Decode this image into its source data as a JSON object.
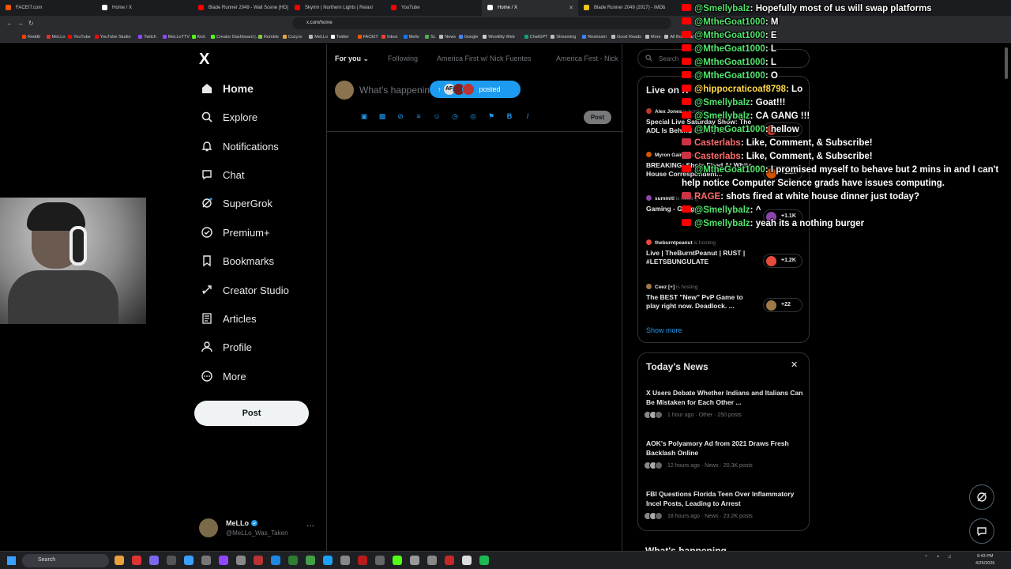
{
  "browser": {
    "tabs": [
      {
        "title": "FACEIT.com",
        "color": "#ff5500"
      },
      {
        "title": "Home / X",
        "color": "#ffffff"
      },
      {
        "title": "Blade Runner 2049 - Wall Scene [HD]",
        "color": "#ff0000"
      },
      {
        "title": "Skyrim | Northern Lights | Relaxi",
        "color": "#ff0000"
      },
      {
        "title": "YouTube",
        "color": "#ff0000"
      },
      {
        "title": "Home / X",
        "color": "#ffffff",
        "active": true
      },
      {
        "title": "Blade Runner 2049 (2017) - IMDb",
        "color": "#f5c518"
      }
    ],
    "url": "x.com/home",
    "bookmarks": [
      {
        "label": "Reddit",
        "color": "#ff4500"
      },
      {
        "label": "MeLLo",
        "color": "#d33"
      },
      {
        "label": "YouTube",
        "color": "#ff0000"
      },
      {
        "label": "YouTube Studio",
        "color": "#ff0000"
      },
      {
        "label": "Twitch",
        "color": "#9146ff"
      },
      {
        "label": "MeLLoTTV",
        "color": "#9146ff"
      },
      {
        "label": "Kick",
        "color": "#53fc18"
      },
      {
        "label": "Creator Dashboard |...",
        "color": "#53fc18"
      },
      {
        "label": "Rumble",
        "color": "#85c742"
      },
      {
        "label": "Cozy.tv",
        "color": "#e8a33d"
      },
      {
        "label": "MeLLo",
        "color": "#bbbbbb"
      },
      {
        "label": "Twitter",
        "color": "#ffffff"
      },
      {
        "label": "FACEIT",
        "color": "#ff5500"
      },
      {
        "label": "Inbox",
        "color": "#ea4335"
      },
      {
        "label": "Mello",
        "color": "#1877f2"
      },
      {
        "label": "SL",
        "color": "#4caf50"
      },
      {
        "label": "News",
        "color": "#bbbbbb"
      },
      {
        "label": "Google",
        "color": "#4285f4"
      },
      {
        "label": "Wootility Web",
        "color": "#cccccc"
      },
      {
        "label": "ChatGPT",
        "color": "#10a37f"
      },
      {
        "label": "Streaming",
        "color": "#bbbbbb"
      },
      {
        "label": "Restream",
        "color": "#3b82f6"
      },
      {
        "label": "Good Reads",
        "color": "#bbbbbb"
      },
      {
        "label": "More",
        "color": "#bbbbbb"
      },
      {
        "label": "All Bookmarks",
        "color": "#bbbbbb"
      }
    ]
  },
  "sidebar": {
    "logo": "X",
    "items": [
      {
        "label": "Home",
        "icon": "home-icon"
      },
      {
        "label": "Explore",
        "icon": "search-icon"
      },
      {
        "label": "Notifications",
        "icon": "bell-icon"
      },
      {
        "label": "Chat",
        "icon": "chat-icon"
      },
      {
        "label": "SuperGrok",
        "icon": "grok-icon"
      },
      {
        "label": "Premium+",
        "icon": "verified-icon"
      },
      {
        "label": "Bookmarks",
        "icon": "bookmark-icon"
      },
      {
        "label": "Creator Studio",
        "icon": "rocket-icon"
      },
      {
        "label": "Articles",
        "icon": "article-icon"
      },
      {
        "label": "Profile",
        "icon": "person-icon"
      },
      {
        "label": "More",
        "icon": "more-circle-icon"
      }
    ],
    "post_label": "Post",
    "account": {
      "name": "MeLLo",
      "handle": "@MeLLo_Was_Taken"
    }
  },
  "timeline": {
    "tabs": [
      {
        "label": "For you",
        "selected": true
      },
      {
        "label": "Following"
      },
      {
        "label": "America First w/ Nick Fuentes"
      },
      {
        "label": "America First - Nick"
      }
    ],
    "composer_placeholder": "What's happening?",
    "posted_label": "posted",
    "posted_avatar_text": "AF",
    "post_label": "Post"
  },
  "right": {
    "search_placeholder": "Search",
    "live_title": "Live on X",
    "live": [
      {
        "host": "Alex Jones",
        "status": "is hosting",
        "title": "Special Live Saturday Show: The ADL Is Behind Gallery B...",
        "count": "+1.6K",
        "color": "#c0392b"
      },
      {
        "host": "Myron Gaines",
        "status": "is hosting",
        "title": "BREAKING: Shots Fired At White House Correspondent...",
        "count": "+1.1K",
        "color": "#d35400"
      },
      {
        "host": "summitl",
        "status": "is hosting",
        "title": "Gaming - Gungeon 2",
        "count": "+1.1K",
        "color": "#8e44ad"
      },
      {
        "host": "theburntpeanut",
        "status": "is hosting",
        "title": "Live | TheBurntPeanut | RUST | #LETSBUNGULATE",
        "count": "+1.2K",
        "color": "#e74c3c"
      },
      {
        "host": "Ceez [+]",
        "status": "is hosting",
        "title": "The BEST \"New\" PvP Game to play right now. Deadlock. ...",
        "count": "+22",
        "color": "#a0794a"
      }
    ],
    "show_more": "Show more",
    "news_title": "Today's News",
    "news": [
      {
        "title": "X Users Debate Whether Indians and Italians Can Be Mistaken for Each Other ...",
        "meta": "1 hour ago · Other · 250 posts"
      },
      {
        "title": "AOK's Polyamory Ad from 2021 Draws Fresh Backlash Online",
        "meta": "12 hours ago · News · 20.3K posts"
      },
      {
        "title": "FBI Questions Florida Teen Over Inflammatory Incel Posts, Leading to Arrest",
        "meta": "18 hours ago · News · 23.2K posts"
      }
    ],
    "whats_happening": "What's happening"
  },
  "chat": [
    {
      "user": "@Smellybalz",
      "text": ": Hopefully most of us will swap platforms",
      "color": "#51e46c"
    },
    {
      "user": "@MtheGoat1000",
      "text": ": M",
      "color": "#51e46c"
    },
    {
      "user": "@MtheGoat1000",
      "text": ": E",
      "color": "#51e46c"
    },
    {
      "user": "@MtheGoat1000",
      "text": ": L",
      "color": "#51e46c"
    },
    {
      "user": "@MtheGoat1000",
      "text": ": L",
      "color": "#51e46c"
    },
    {
      "user": "@MtheGoat1000",
      "text": ": O",
      "color": "#51e46c"
    },
    {
      "user": "@hippocraticoaf8798",
      "text": ": Lo",
      "color": "#ffd84a"
    },
    {
      "user": "@Smellybalz",
      "text": ": Goat!!!",
      "color": "#51e46c"
    },
    {
      "user": "@Smellybalz",
      "text": ": CA GANG !!!",
      "color": "#51e46c"
    },
    {
      "user": "@MtheGoat1000",
      "text": ": hellow",
      "color": "#51e46c"
    },
    {
      "user": "Casterlabs",
      "text": ": Like, Comment, & Subscribe!",
      "color": "#ff6b6b"
    },
    {
      "user": "Casterlabs",
      "text": ": Like, Comment, & Subscribe!",
      "color": "#ff6b6b"
    },
    {
      "user": "@MtheGoat1000",
      "text": ": I promised myself to behave but 2 mins in and I can't help notice Computer Science grads have issues computing.",
      "color": "#51e46c"
    },
    {
      "user": "RAGE",
      "text": ": shots fired at white house dinner just today?",
      "color": "#ff6b6b"
    },
    {
      "user": "@Smellybalz",
      "text": ": ^",
      "color": "#51e46c"
    },
    {
      "user": "@Smellybalz",
      "text": ": yeah its a nothing burger",
      "color": "#51e46c"
    }
  ],
  "taskbar": {
    "search": "Search",
    "time": "9:43 PM",
    "date": "4/25/2026"
  }
}
